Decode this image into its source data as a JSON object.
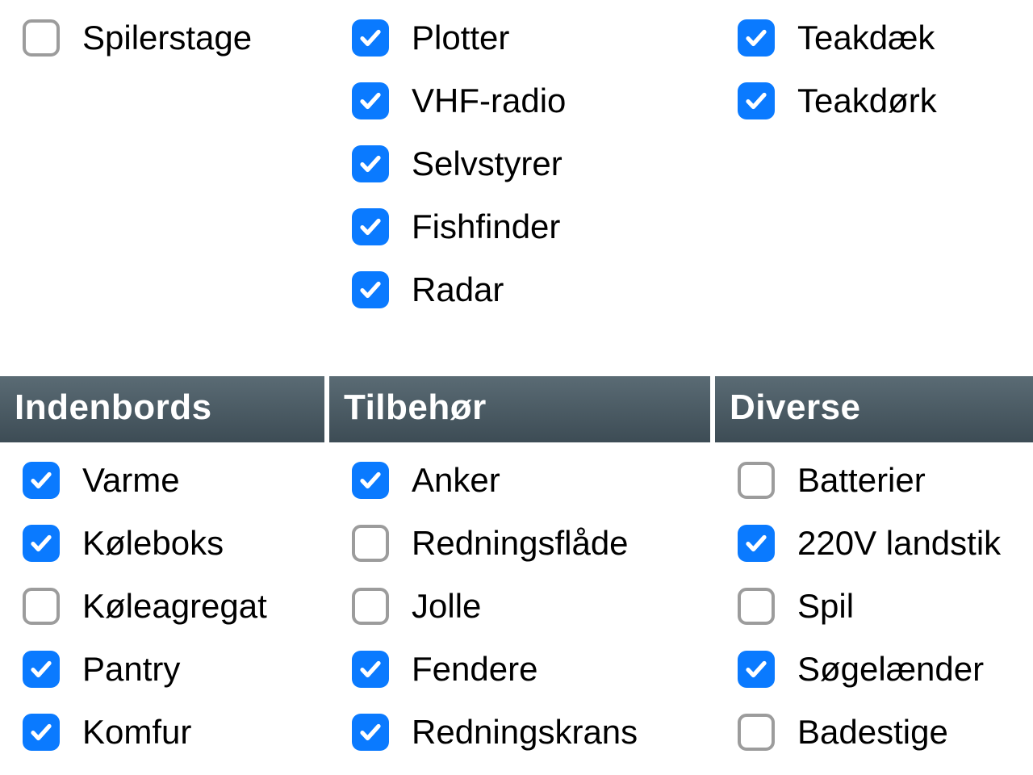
{
  "colors": {
    "accent": "#0a7aff",
    "header_bg_top": "#5a6b74",
    "header_bg_bottom": "#3d4c55"
  },
  "top": {
    "colA": [
      {
        "label": "Spilerstage",
        "checked": false
      }
    ],
    "colB": [
      {
        "label": "Plotter",
        "checked": true
      },
      {
        "label": "VHF-radio",
        "checked": true
      },
      {
        "label": "Selvstyrer",
        "checked": true
      },
      {
        "label": "Fishfinder",
        "checked": true
      },
      {
        "label": "Radar",
        "checked": true
      }
    ],
    "colC": [
      {
        "label": "Teakdæk",
        "checked": true
      },
      {
        "label": "Teakdørk",
        "checked": true
      }
    ]
  },
  "sections": {
    "colA": {
      "header": "Indenbords",
      "items": [
        {
          "label": "Varme",
          "checked": true
        },
        {
          "label": "Køleboks",
          "checked": true
        },
        {
          "label": "Køleagregat",
          "checked": false
        },
        {
          "label": "Pantry",
          "checked": true
        },
        {
          "label": "Komfur",
          "checked": true
        }
      ]
    },
    "colB": {
      "header": "Tilbehør",
      "items": [
        {
          "label": "Anker",
          "checked": true
        },
        {
          "label": "Redningsflåde",
          "checked": false
        },
        {
          "label": "Jolle",
          "checked": false
        },
        {
          "label": "Fendere",
          "checked": true
        },
        {
          "label": "Redningskrans",
          "checked": true
        }
      ]
    },
    "colC": {
      "header": "Diverse",
      "items": [
        {
          "label": "Batterier",
          "checked": false
        },
        {
          "label": "220V landstik",
          "checked": true
        },
        {
          "label": "Spil",
          "checked": false
        },
        {
          "label": "Søgelænder",
          "checked": true
        },
        {
          "label": "Badestige",
          "checked": false
        }
      ]
    }
  }
}
